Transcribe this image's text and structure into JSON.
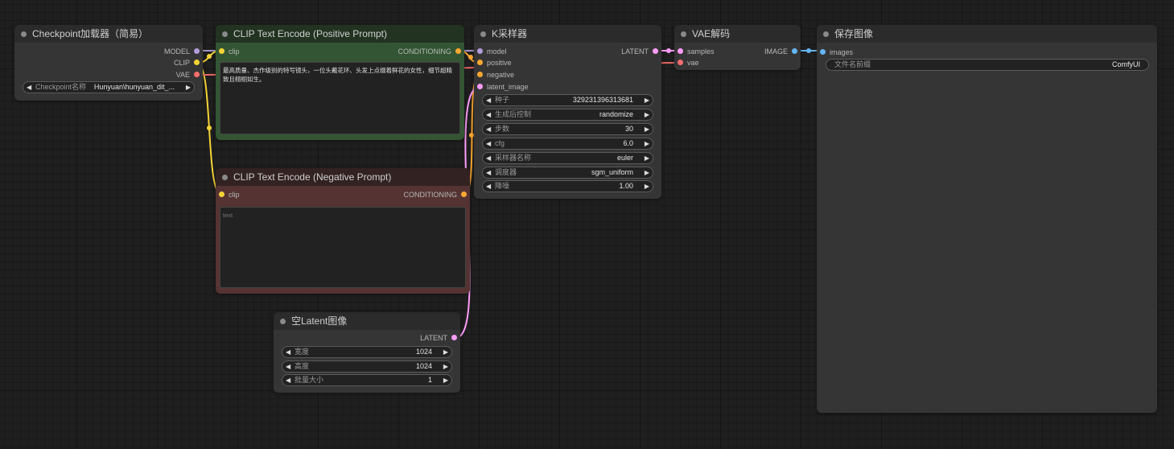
{
  "colors": {
    "model": "#b39ddb",
    "clip": "#f5d337",
    "vae": "#ff6e6e",
    "conditioning": "#ffa931",
    "latent": "#ff9cf9",
    "image": "#64b5f6"
  },
  "nodes": {
    "checkpoint": {
      "title": "Checkpoint加载器（简易）",
      "outputs": [
        "MODEL",
        "CLIP",
        "VAE"
      ],
      "widget": {
        "label": "Checkpoint名称",
        "value": "Hunyuan\\hunyuan_dit_..."
      }
    },
    "clip_positive": {
      "title": "CLIP Text Encode (Positive Prompt)",
      "input": "clip",
      "output": "CONDITIONING",
      "text": "最高质量、杰作级别的特写镜头，一位头戴花环、头发上点缀着鲜花的女性，细节超精致且栩栩如生。"
    },
    "clip_negative": {
      "title": "CLIP Text Encode (Negative Prompt)",
      "input": "clip",
      "output": "CONDITIONING",
      "placeholder": "text"
    },
    "ksampler": {
      "title": "K采样器",
      "inputs": [
        "model",
        "positive",
        "negative",
        "latent_image"
      ],
      "output": "LATENT",
      "widgets": [
        {
          "label": "种子",
          "value": "329231396313681"
        },
        {
          "label": "生成后控制",
          "value": "randomize"
        },
        {
          "label": "步数",
          "value": "30"
        },
        {
          "label": "cfg",
          "value": "6.0"
        },
        {
          "label": "采样器名称",
          "value": "euler"
        },
        {
          "label": "调度器",
          "value": "sgm_uniform"
        },
        {
          "label": "降噪",
          "value": "1.00"
        }
      ]
    },
    "vae_decode": {
      "title": "VAE解码",
      "inputs": [
        "samples",
        "vae"
      ],
      "output": "IMAGE"
    },
    "save_image": {
      "title": "保存图像",
      "input": "images",
      "widget": {
        "label": "文件名前缀",
        "value": "ComfyUI"
      }
    },
    "empty_latent": {
      "title": "空Latent图像",
      "output": "LATENT",
      "widgets": [
        {
          "label": "宽度",
          "value": "1024"
        },
        {
          "label": "高度",
          "value": "1024"
        },
        {
          "label": "批量大小",
          "value": "1"
        }
      ]
    }
  }
}
